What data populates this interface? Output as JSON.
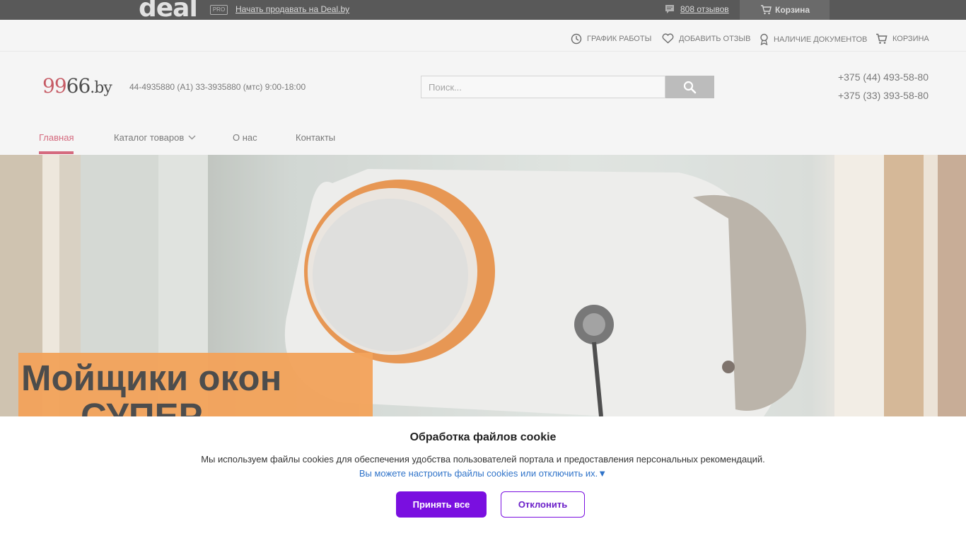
{
  "topbar": {
    "logo": "deal",
    "pro_badge": "PRO",
    "sell_link": "Начать продавать на Deal.by",
    "reviews": "808 отзывов",
    "cart": "Корзина"
  },
  "util": {
    "schedule": "График работы",
    "review": "Добавить отзыв",
    "docs": "Наличие документов",
    "cart": "Корзина"
  },
  "brand": {
    "part1": "99",
    "part2": "66",
    "part3": ".by"
  },
  "contact": "44-4935880 (А1) 33-3935880 (мтс) 9:00-18:00",
  "search": {
    "placeholder": "Поиск..."
  },
  "phones": [
    "+375 (44) 493-58-80",
    "+375 (33) 393-58-80"
  ],
  "nav": {
    "home": "Главная",
    "catalog": "Каталог товаров",
    "about": "О нас",
    "contacts": "Контакты"
  },
  "banner": {
    "line1": "Мойщики окон",
    "line2": "СУПЕР"
  },
  "cookie": {
    "title": "Обработка файлов cookie",
    "text": "Мы используем файлы cookies для обеспечения удобства пользователей портала и предоставления персональных рекомендаций.",
    "link": "Вы можете настроить файлы cookies или отключить их.▼",
    "accept": "Принять все",
    "decline": "Отклонить"
  },
  "colors": {
    "accent": "#c9405a",
    "cookie_button": "#7a0fe0",
    "topbar": "#2b2b2b"
  }
}
